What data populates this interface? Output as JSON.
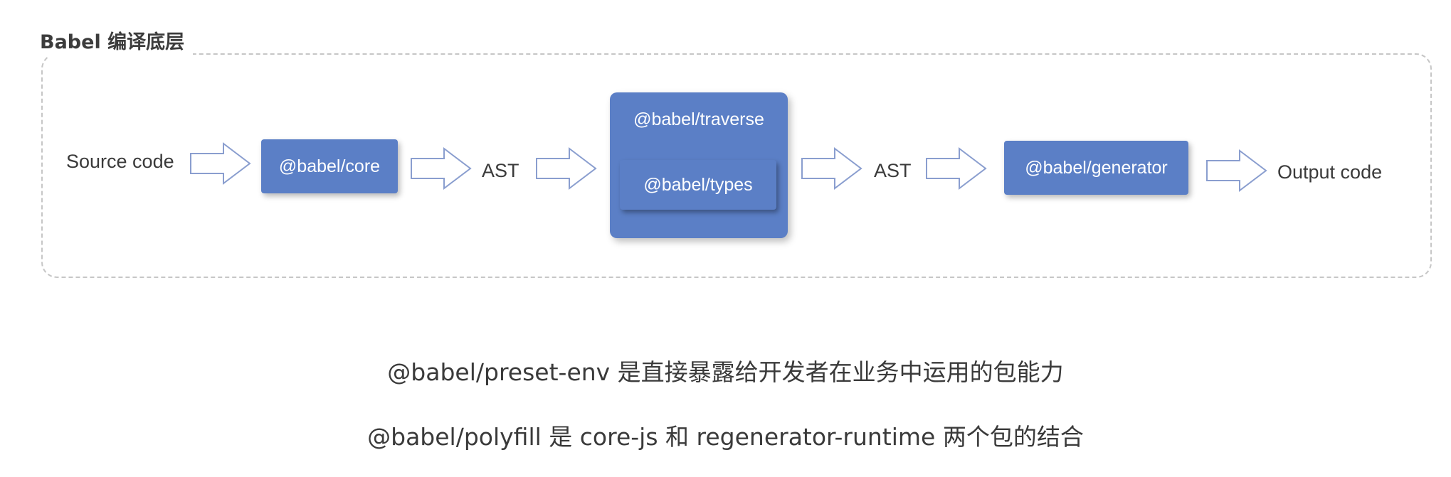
{
  "frame": {
    "title": "Babel 编译底层"
  },
  "flow": {
    "source_label": "Source code",
    "core_box": "@babel/core",
    "ast_1": "AST",
    "traverse_box": "@babel/traverse",
    "types_box": "@babel/types",
    "ast_2": "AST",
    "generator_box": "@babel/generator",
    "output_label": "Output code"
  },
  "captions": {
    "line1": "@babel/preset-env 是直接暴露给开发者在业务中运用的包能力",
    "line2": "@babel/polyfill 是 core-js 和 regenerator-runtime 两个包的结合"
  },
  "colors": {
    "box_fill": "#5b7fc6",
    "arrow_stroke": "#8a9ecf",
    "frame_border": "#c6c6c6"
  },
  "icons": {
    "arrow": "hollow-right-arrow-icon"
  }
}
